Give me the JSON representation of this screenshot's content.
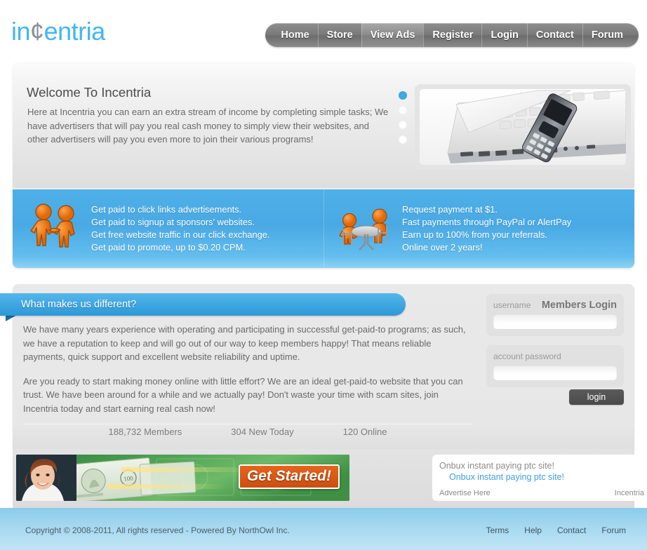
{
  "site": {
    "logo_text_1": "in",
    "logo_cent": "¢",
    "logo_text_2": "entria",
    "logo_full": "incentria"
  },
  "nav": {
    "items": [
      {
        "label": "Home",
        "active": false
      },
      {
        "label": "Store",
        "active": false
      },
      {
        "label": "View Ads",
        "active": true
      },
      {
        "label": "Register",
        "active": false
      },
      {
        "label": "Login",
        "active": false
      },
      {
        "label": "Contact",
        "active": false
      },
      {
        "label": "Forum",
        "active": false
      }
    ]
  },
  "welcome": {
    "title": "Welcome To Incentria",
    "body": "Here at Incentria you can earn an extra stream of income by completing simple tasks; We have advertisers that will pay you real cash money to simply view their websites, and other advertisers will pay you even more to join their various programs!",
    "slides": {
      "count": 4,
      "active_index": 0
    },
    "slide_image_alt": "laptop-with-mobile-phone"
  },
  "features": {
    "left": {
      "icon": "handshake-figures-icon",
      "lines": [
        "Get paid to click links advertisements.",
        "Get paid to signup at sponsors' websites.",
        "Get free website traffic in our click exchange.",
        "Get paid to promote, up to $0.20 CPM."
      ]
    },
    "right": {
      "icon": "figures-at-table-icon",
      "lines": [
        "Request payment at $1.",
        "Fast payments through PayPal or AlertPay",
        "Earn up to 100% from your referrals.",
        "Online over 2 years!"
      ]
    }
  },
  "ribbon": {
    "title": "What makes us different?"
  },
  "about": {
    "paragraph1": "We have many years experience with operating and participating in successful get-paid-to programs; as such, we have a reputation to keep and will go out of our way to keep members happy! That means reliable payments, quick support and excellent website reliability and uptime.",
    "paragraph2": "Are you ready to start making money online with little effort? We are an ideal get-paid-to website that you can trust. We have been around for a while and we actually pay! Don't waste your time with scam sites, join Incentria today and start earning real cash now!"
  },
  "stats": {
    "members": "188,732 Members",
    "new_today": "304 New Today",
    "online": "120 Online"
  },
  "login": {
    "title": "Members Login",
    "username_label": "username",
    "username_value": "",
    "password_label": "account password",
    "password_value": "",
    "button_label": "login"
  },
  "ads": {
    "banner": {
      "cta": "Get Started!",
      "alt": "money-background-woman-banner"
    },
    "text_ad": {
      "title": "Onbux instant paying ptc site!",
      "link": "Onbux instant paying ptc site!",
      "advertise": "Advertise Here",
      "site": "Incentria"
    }
  },
  "footer": {
    "copyright": "Copyright © 2008-2011, All rights reserved - Powered By NorthOwl Inc.",
    "links": [
      "Terms",
      "Help",
      "Contact",
      "Forum"
    ]
  },
  "colors": {
    "accent_blue": "#3fa9e0",
    "logo_blue": "#45b6f0",
    "band_blue": "#4fb0e8",
    "footer_blue": "#a6d8f0",
    "orange": "#e8641a"
  }
}
